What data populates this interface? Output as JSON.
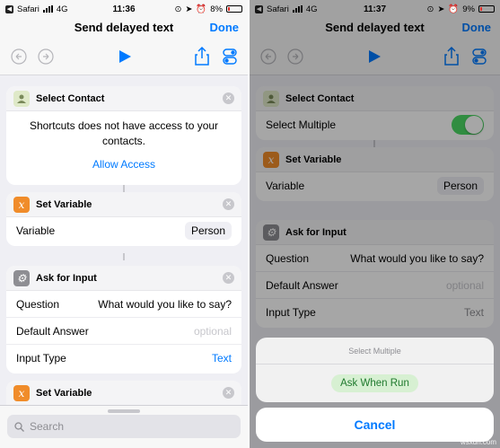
{
  "left": {
    "status": {
      "back_app": "Safari",
      "network": "4G",
      "time": "11:36",
      "battery": "8%"
    },
    "nav": {
      "title": "Send delayed text",
      "done": "Done"
    },
    "select_contact": {
      "title": "Select Contact",
      "message": "Shortcuts does not have access to your contacts.",
      "action": "Allow Access"
    },
    "set_variable_1": {
      "title": "Set Variable",
      "label": "Variable",
      "value": "Person"
    },
    "ask_input": {
      "title": "Ask for Input",
      "rows": [
        {
          "label": "Question",
          "value": "What would you like to say?"
        },
        {
          "label": "Default Answer",
          "value": "optional"
        },
        {
          "label": "Input Type",
          "value": "Text"
        }
      ]
    },
    "set_variable_2": {
      "title": "Set Variable"
    },
    "search": {
      "placeholder": "Search"
    }
  },
  "right": {
    "status": {
      "back_app": "Safari",
      "network": "4G",
      "time": "11:37",
      "battery": "9%"
    },
    "nav": {
      "title": "Send delayed text",
      "done": "Done"
    },
    "select_contact": {
      "title": "Select Contact",
      "label": "Select Multiple",
      "toggle_on": true
    },
    "set_variable": {
      "title": "Set Variable",
      "label": "Variable",
      "value": "Person"
    },
    "ask_input": {
      "title": "Ask for Input",
      "rows": [
        {
          "label": "Question",
          "value": "What would you like to say?"
        },
        {
          "label": "Default Answer",
          "value": "optional"
        },
        {
          "label": "Input Type",
          "value": "Text"
        }
      ]
    },
    "sheet": {
      "title": "Select Multiple",
      "option": "Ask When Run",
      "cancel": "Cancel"
    }
  },
  "watermark": "wsxdn.com",
  "colors": {
    "accent": "#007aff",
    "toggle_on": "#4cd964",
    "variable_icon": "#f08c2a"
  }
}
